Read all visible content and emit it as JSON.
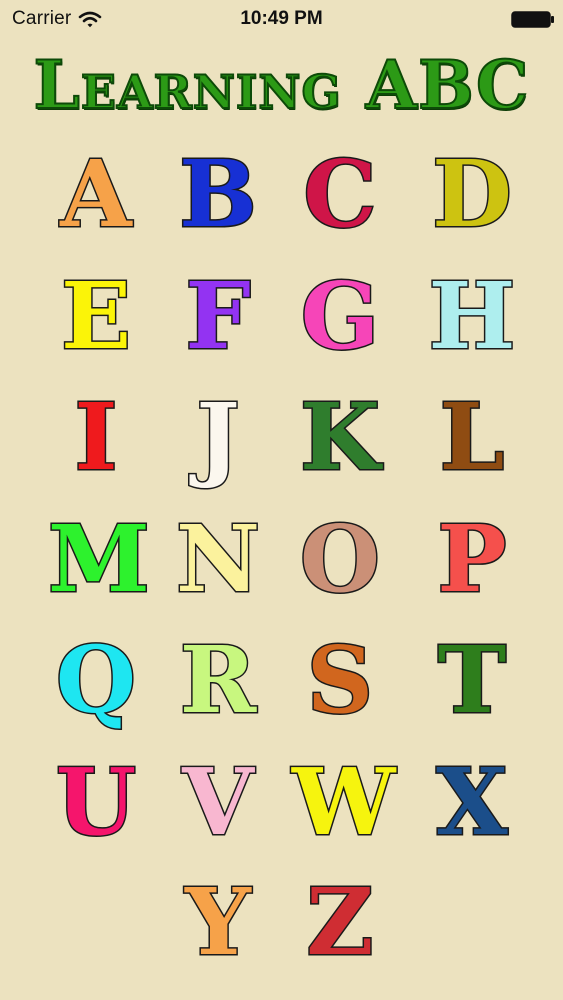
{
  "status_bar": {
    "carrier": "Carrier",
    "time": "10:49 PM",
    "wifi_icon": "wifi-icon",
    "battery_icon": "battery-icon"
  },
  "app": {
    "title": "Learning ABC"
  },
  "letters": [
    {
      "char": "A",
      "color": "#f6a249"
    },
    {
      "char": "B",
      "color": "#1730d4"
    },
    {
      "char": "C",
      "color": "#cf1548"
    },
    {
      "char": "D",
      "color": "#cdc311"
    },
    {
      "char": "E",
      "color": "#fbf408"
    },
    {
      "char": "F",
      "color": "#9333f2"
    },
    {
      "char": "G",
      "color": "#f645b8"
    },
    {
      "char": "H",
      "color": "#aeeeee"
    },
    {
      "char": "I",
      "color": "#ef1a1d"
    },
    {
      "char": "J",
      "color": "#fbf7ee"
    },
    {
      "char": "K",
      "color": "#2f7d2d"
    },
    {
      "char": "L",
      "color": "#8f4c12"
    },
    {
      "char": "M",
      "color": "#2df22d"
    },
    {
      "char": "N",
      "color": "#fbf29d"
    },
    {
      "char": "O",
      "color": "#cb9077"
    },
    {
      "char": "P",
      "color": "#f5504c"
    },
    {
      "char": "Q",
      "color": "#1ee6f1"
    },
    {
      "char": "R",
      "color": "#c8f77f"
    },
    {
      "char": "S",
      "color": "#d1661e"
    },
    {
      "char": "T",
      "color": "#2e7e1c"
    },
    {
      "char": "U",
      "color": "#f5156c"
    },
    {
      "char": "V",
      "color": "#f8b7d0"
    },
    {
      "char": "W",
      "color": "#f6f40e"
    },
    {
      "char": "X",
      "color": "#1b4e8a"
    },
    {
      "char": "Y",
      "color": "#f6a249"
    },
    {
      "char": "Z",
      "color": "#cf2d33"
    }
  ]
}
